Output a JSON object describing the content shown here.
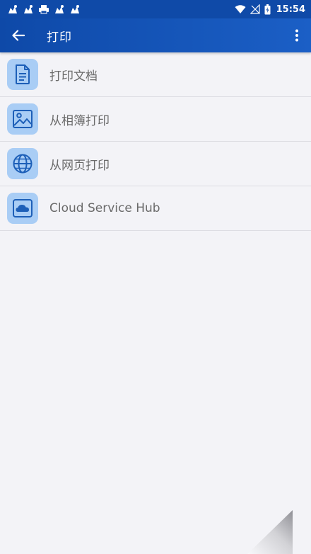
{
  "status_bar": {
    "time": "15:54"
  },
  "app_bar": {
    "title": "打印",
    "back_icon": "arrow-left-icon",
    "menu_icon": "more-vert-icon"
  },
  "menu": {
    "items": [
      {
        "label": "打印文档",
        "icon": "document-icon"
      },
      {
        "label": "从相簿打印",
        "icon": "image-icon"
      },
      {
        "label": "从网页打印",
        "icon": "globe-icon"
      },
      {
        "label": "Cloud Service Hub",
        "icon": "cloud-icon"
      }
    ]
  },
  "colors": {
    "primary": "#0f4aa8",
    "icon_bg": "#a9cdf5",
    "icon_fg": "#1d5fb8",
    "background": "#f3f3f7",
    "text": "#6a6a6a"
  }
}
